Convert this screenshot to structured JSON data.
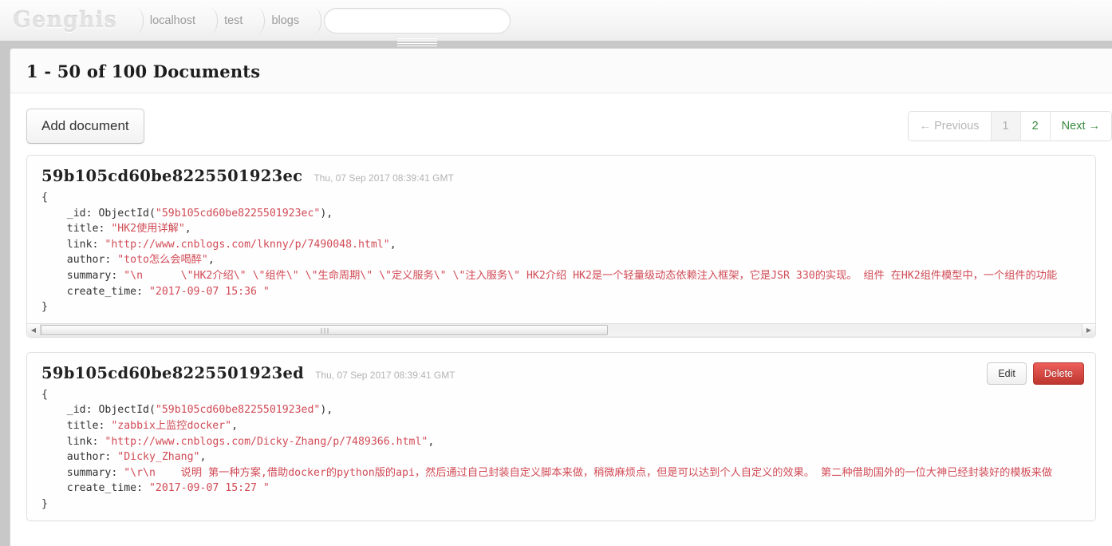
{
  "app": {
    "logo": "Genghis"
  },
  "breadcrumbs": [
    {
      "label": "localhost"
    },
    {
      "label": "test"
    },
    {
      "label": "blogs"
    }
  ],
  "search": {
    "value": "",
    "placeholder": ""
  },
  "page": {
    "title": "1 - 50 of 100 Documents"
  },
  "toolbar": {
    "add_label": "Add document"
  },
  "pagination": {
    "previous": "← Previous",
    "pages": [
      {
        "label": "1",
        "state": "current"
      },
      {
        "label": "2",
        "state": "link"
      }
    ],
    "next": "Next →"
  },
  "actions": {
    "edit": "Edit",
    "delete": "Delete"
  },
  "documents": [
    {
      "id": "59b105cd60be8225501923ec",
      "timestamp": "Thu, 07 Sep 2017 08:39:41 GMT",
      "json_lines": [
        {
          "parts": [
            {
              "t": "{",
              "c": "jkey"
            }
          ]
        },
        {
          "parts": [
            {
              "t": "    _id: ObjectId(",
              "c": "jkey"
            },
            {
              "t": "\"59b105cd60be8225501923ec\"",
              "c": "jstr"
            },
            {
              "t": "),",
              "c": "jkey"
            }
          ]
        },
        {
          "parts": [
            {
              "t": "    title: ",
              "c": "jkey"
            },
            {
              "t": "\"HK2使用详解\"",
              "c": "jstr"
            },
            {
              "t": ",",
              "c": "jkey"
            }
          ]
        },
        {
          "parts": [
            {
              "t": "    link: ",
              "c": "jkey"
            },
            {
              "t": "\"http://www.cnblogs.com/lknny/p/7490048.html\"",
              "c": "jstr"
            },
            {
              "t": ",",
              "c": "jkey"
            }
          ]
        },
        {
          "parts": [
            {
              "t": "    author: ",
              "c": "jkey"
            },
            {
              "t": "\"toto怎么会喝醉\"",
              "c": "jstr"
            },
            {
              "t": ",",
              "c": "jkey"
            }
          ]
        },
        {
          "parts": [
            {
              "t": "    summary: ",
              "c": "jkey"
            },
            {
              "t": "\"\\n      \\\"HK2介绍\\\" \\\"组件\\\" \\\"生命周期\\\" \\\"定义服务\\\" \\\"注入服务\\\" HK2介绍 HK2是一个轻量级动态依赖注入框架，它是JSR 330的实现。 组件 在HK2组件模型中，一个组件的功能",
              "c": "jstr"
            }
          ]
        },
        {
          "parts": [
            {
              "t": "    create_time: ",
              "c": "jkey"
            },
            {
              "t": "\"2017-09-07 15:36 \"",
              "c": "jstr"
            }
          ]
        },
        {
          "parts": [
            {
              "t": "}",
              "c": "jkey"
            }
          ]
        }
      ],
      "has_scrollbar": true,
      "show_actions": false
    },
    {
      "id": "59b105cd60be8225501923ed",
      "timestamp": "Thu, 07 Sep 2017 08:39:41 GMT",
      "json_lines": [
        {
          "parts": [
            {
              "t": "{",
              "c": "jkey"
            }
          ]
        },
        {
          "parts": [
            {
              "t": "    _id: ObjectId(",
              "c": "jkey"
            },
            {
              "t": "\"59b105cd60be8225501923ed\"",
              "c": "jstr"
            },
            {
              "t": "),",
              "c": "jkey"
            }
          ]
        },
        {
          "parts": [
            {
              "t": "    title: ",
              "c": "jkey"
            },
            {
              "t": "\"zabbix上监控docker\"",
              "c": "jstr"
            },
            {
              "t": ",",
              "c": "jkey"
            }
          ]
        },
        {
          "parts": [
            {
              "t": "    link: ",
              "c": "jkey"
            },
            {
              "t": "\"http://www.cnblogs.com/Dicky-Zhang/p/7489366.html\"",
              "c": "jstr"
            },
            {
              "t": ",",
              "c": "jkey"
            }
          ]
        },
        {
          "parts": [
            {
              "t": "    author: ",
              "c": "jkey"
            },
            {
              "t": "\"Dicky_Zhang\"",
              "c": "jstr"
            },
            {
              "t": ",",
              "c": "jkey"
            }
          ]
        },
        {
          "parts": [
            {
              "t": "    summary: ",
              "c": "jkey"
            },
            {
              "t": "\"\\r\\n    说明 第一种方案,借助docker的python版的api，然后通过自己封装自定义脚本来做，稍微麻烦点，但是可以达到个人自定义的效果。 第二种借助国外的一位大神已经封装好的模板来做",
              "c": "jstr"
            }
          ]
        },
        {
          "parts": [
            {
              "t": "    create_time: ",
              "c": "jkey"
            },
            {
              "t": "\"2017-09-07 15:27 \"",
              "c": "jstr"
            }
          ]
        },
        {
          "parts": [
            {
              "t": "}",
              "c": "jkey"
            }
          ]
        }
      ],
      "has_scrollbar": false,
      "show_actions": true
    }
  ],
  "scrollbar": {
    "left_arrow": "◀",
    "right_arrow": "▶",
    "thumb_percent": 54.5
  },
  "colors": {
    "string": "#d14b56",
    "link_green": "#3a8a41",
    "delete_red": "#bd362f"
  }
}
